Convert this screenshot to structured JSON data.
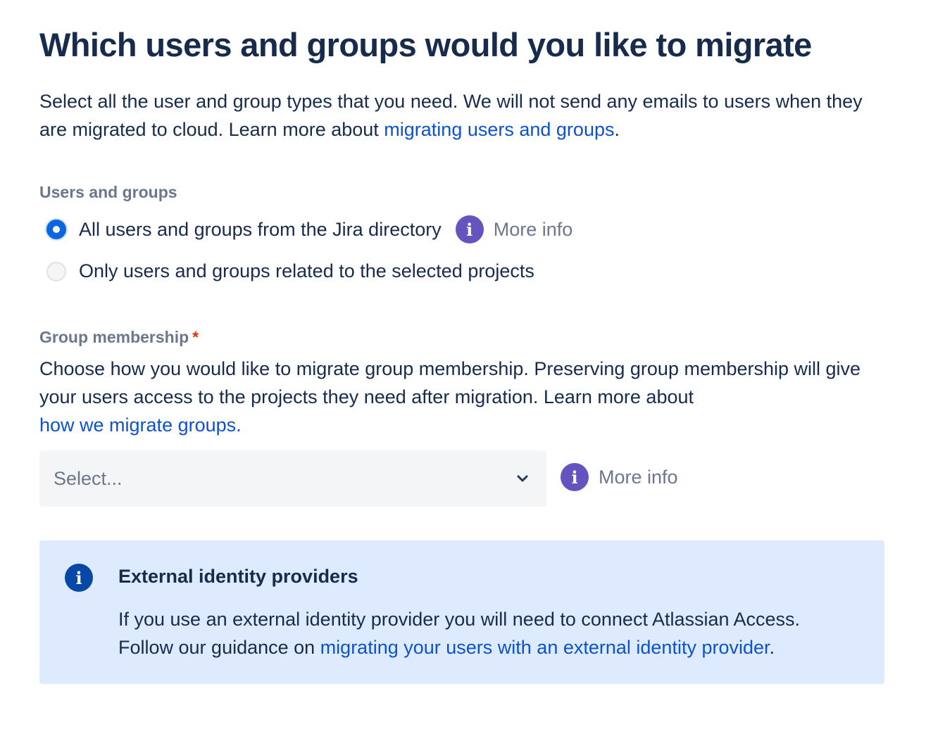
{
  "title": "Which users and groups would you like to migrate",
  "intro": {
    "text": "Select all the user and group types that you need. We will not send any emails to users when they are migrated to cloud. Learn more about ",
    "link": "migrating users and groups",
    "suffix": "."
  },
  "users_groups": {
    "label": "Users and groups",
    "options": [
      {
        "label": "All users and groups from the Jira directory",
        "selected": true,
        "more_info": "More info"
      },
      {
        "label": "Only users and groups related to the selected projects",
        "selected": false
      }
    ]
  },
  "group_membership": {
    "label": "Group membership",
    "required_mark": "*",
    "description": "Choose how you would like to migrate group membership. Preserving group membership will give your users access to the projects they need after migration. Learn more about ",
    "link": "how we migrate groups.",
    "select_placeholder": "Select...",
    "more_info": "More info"
  },
  "banner": {
    "title": "External identity providers",
    "line1": "If you use an external identity provider you will need to connect Atlassian Access.",
    "line2_prefix": "Follow our guidance on ",
    "line2_link": "migrating your users with an external identity provider",
    "line2_suffix": "."
  },
  "icons": {
    "info_glyph": "i",
    "radio_icon": "radio-button",
    "chevron_icon": "chevron-down-icon"
  },
  "colors": {
    "text": "#172b4d",
    "subtle": "#6b778c",
    "link": "#0c52cc",
    "info_purple": "#6554c0",
    "radio_blue": "#0c66e4",
    "banner_bg": "#deebff",
    "banner_icon": "#0747a6",
    "required": "#de350b"
  }
}
